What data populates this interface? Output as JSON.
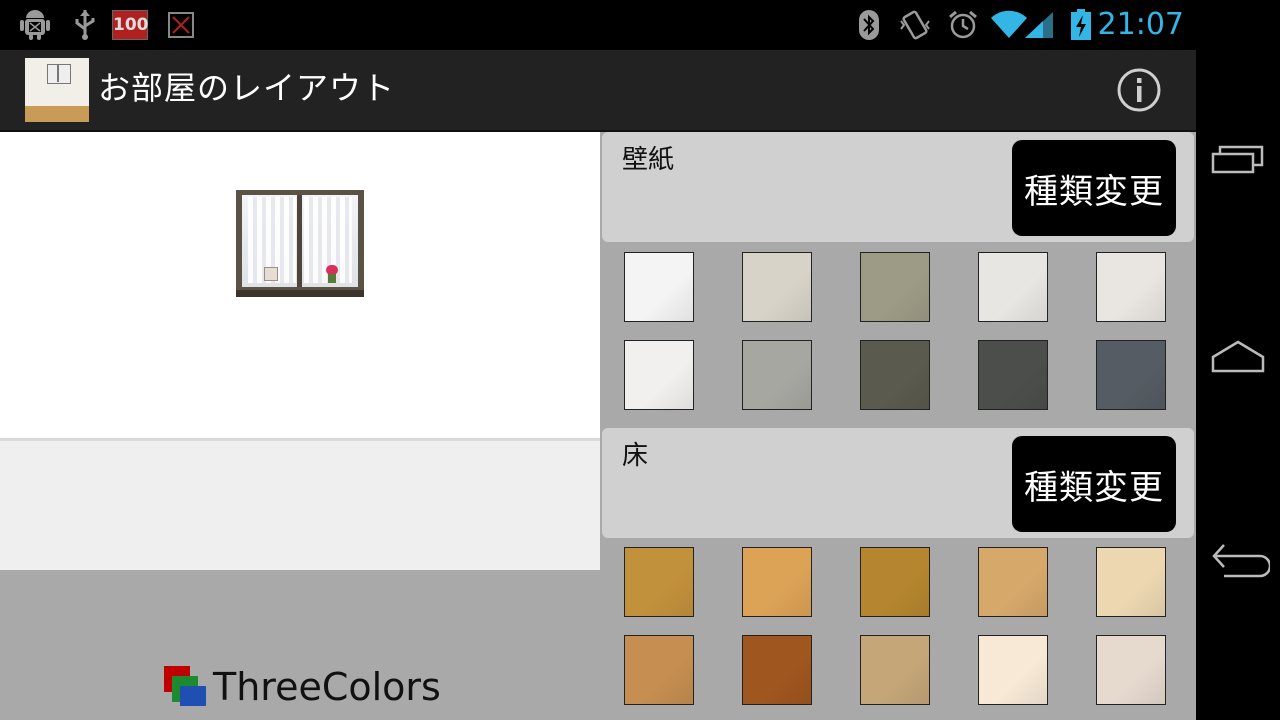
{
  "status_bar": {
    "left_icons": [
      "android-debug-icon",
      "usb-icon",
      "battery-100-badge-icon",
      "no-sim-icon"
    ],
    "battery_badge_text": "100",
    "right_icons": [
      "bluetooth-icon",
      "vibrate-icon",
      "alarm-icon",
      "wifi-icon",
      "signal-icon",
      "battery-charging-icon"
    ],
    "clock": "21:07",
    "clock_color": "#33b5e5"
  },
  "action_bar": {
    "title": "お部屋のレイアウト",
    "info_icon": "info-icon"
  },
  "room_preview": {
    "wall_color": "#ffffff",
    "floor_color": "#efefef"
  },
  "branding": {
    "logo_text": "ThreeColors",
    "logo_colors": [
      "#c00000",
      "#1c8a2e",
      "#1f4fb0"
    ]
  },
  "wallpaper_section": {
    "label": "壁紙",
    "change_button": "種類変更",
    "swatches": [
      {
        "name": "wall-swatch-1",
        "color": "#f4f4f4"
      },
      {
        "name": "wall-swatch-2",
        "color": "#d8d3c9"
      },
      {
        "name": "wall-swatch-3",
        "color": "#9d9b86"
      },
      {
        "name": "wall-swatch-4",
        "color": "#e8e6e2"
      },
      {
        "name": "wall-swatch-5",
        "color": "#e9e5e0"
      },
      {
        "name": "wall-swatch-6",
        "color": "#f1f0ee"
      },
      {
        "name": "wall-swatch-7",
        "color": "#a7a7a2"
      },
      {
        "name": "wall-swatch-8",
        "color": "#5a5a4e"
      },
      {
        "name": "wall-swatch-9",
        "color": "#4c4e4b"
      },
      {
        "name": "wall-swatch-10",
        "color": "#565c63"
      }
    ]
  },
  "floor_section": {
    "label": "床",
    "change_button": "種類変更",
    "swatches": [
      {
        "name": "floor-swatch-1",
        "color": "#c2913c"
      },
      {
        "name": "floor-swatch-2",
        "color": "#dca356"
      },
      {
        "name": "floor-swatch-3",
        "color": "#b5862f"
      },
      {
        "name": "floor-swatch-4",
        "color": "#d6a86a"
      },
      {
        "name": "floor-swatch-5",
        "color": "#ecd7b0"
      },
      {
        "name": "floor-swatch-6",
        "color": "#c68e51"
      },
      {
        "name": "floor-swatch-7",
        "color": "#a0561f"
      },
      {
        "name": "floor-swatch-8",
        "color": "#c4a678"
      },
      {
        "name": "floor-swatch-9",
        "color": "#f8e9d6"
      },
      {
        "name": "floor-swatch-10",
        "color": "#e6d9ce"
      }
    ]
  },
  "nav_bar": {
    "buttons": [
      "recent-apps-icon",
      "home-icon",
      "back-icon"
    ]
  }
}
